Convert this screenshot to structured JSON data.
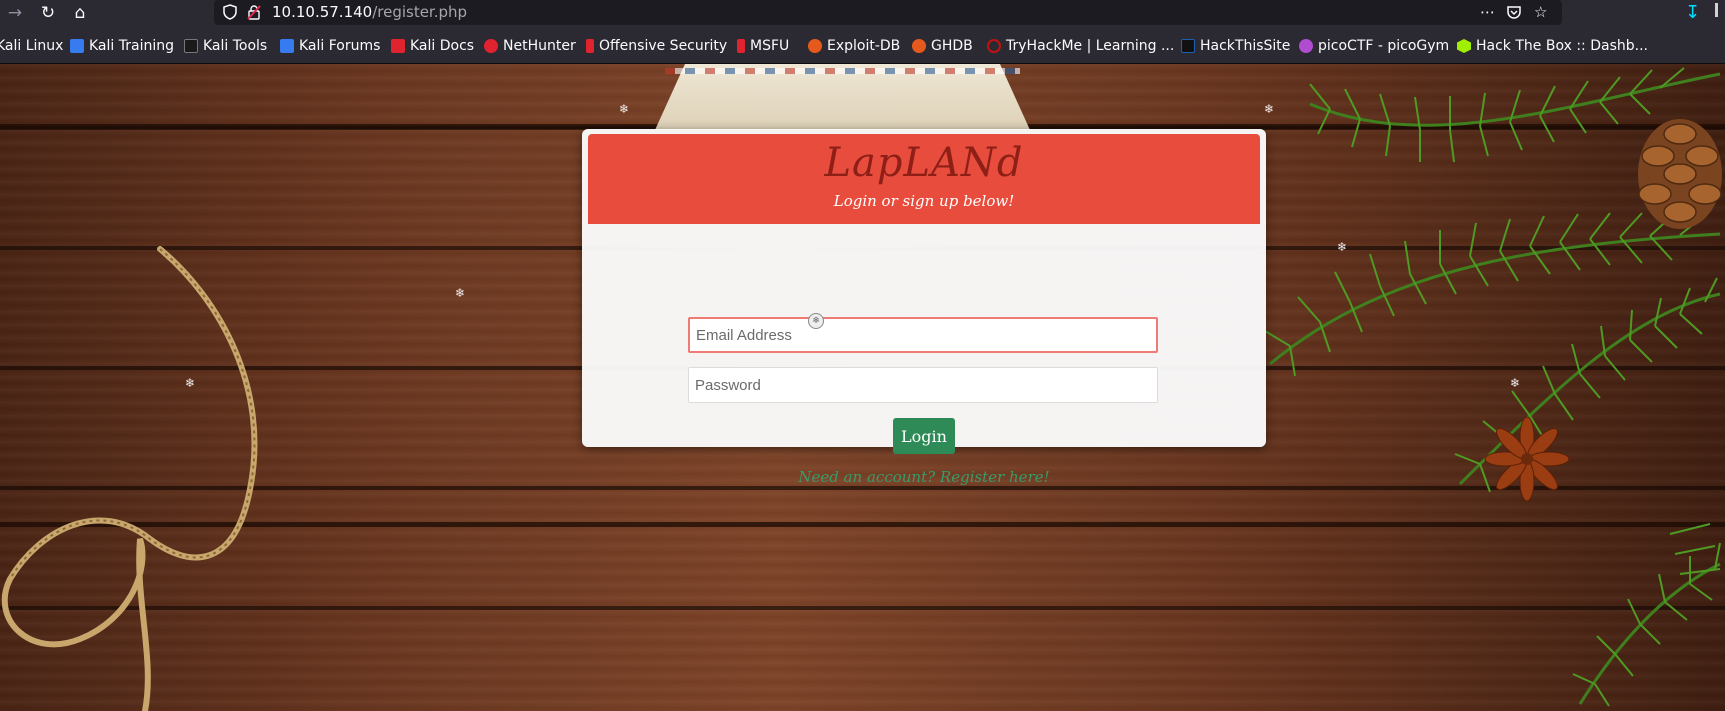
{
  "browser": {
    "url_host": "10.10.57.140",
    "url_path": "/register.php"
  },
  "bookmarks": [
    {
      "label": "Kali Linux",
      "icon": "kali-icon",
      "color": "#367bf0"
    },
    {
      "label": "Kali Training",
      "icon": "kali-training-icon",
      "color": "#367bf0"
    },
    {
      "label": "Kali Tools",
      "icon": "kali-tools-icon",
      "color": "#000000"
    },
    {
      "label": "Kali Forums",
      "icon": "kali-forums-icon",
      "color": "#367bf0"
    },
    {
      "label": "Kali Docs",
      "icon": "kali-docs-icon",
      "color": "#e0242f"
    },
    {
      "label": "NetHunter",
      "icon": "nethunter-icon",
      "color": "#e0242f"
    },
    {
      "label": "Offensive Security",
      "icon": "offsec-icon",
      "color": "#e0242f"
    },
    {
      "label": "MSFU",
      "icon": "msfu-icon",
      "color": "#e0242f"
    },
    {
      "label": "Exploit-DB",
      "icon": "exploit-db-icon",
      "color": "#e55a1c"
    },
    {
      "label": "GHDB",
      "icon": "ghdb-icon",
      "color": "#e55a1c"
    },
    {
      "label": "TryHackMe | Learning ...",
      "icon": "tryhackme-icon",
      "color": "#c11111"
    },
    {
      "label": "HackThisSite",
      "icon": "hackthissite-icon",
      "color": "#1f5fb0"
    },
    {
      "label": "picoCTF - picoGym",
      "icon": "picoctf-icon",
      "color": "#b04cd0"
    },
    {
      "label": "Hack The Box :: Dashb...",
      "icon": "hackthebox-icon",
      "color": "#9fef00"
    }
  ],
  "login": {
    "brand": "LapLANd",
    "tagline": "Login or sign up below!",
    "email_placeholder": "Email Address",
    "password_placeholder": "Password",
    "login_button": "Login",
    "register_link": "Need an account? Register here!"
  },
  "colors": {
    "header_red": "#e74c3c",
    "button_green": "#2e8b57",
    "link_green": "#3a9a68"
  }
}
